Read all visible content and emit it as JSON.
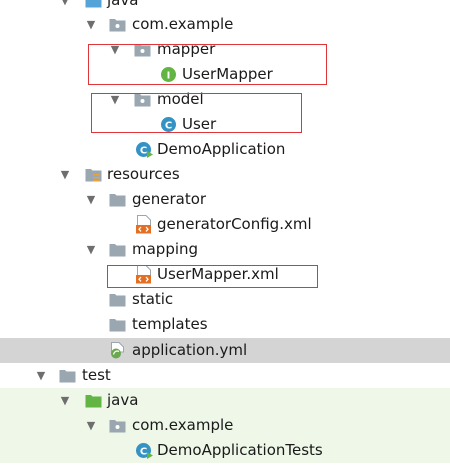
{
  "tree": {
    "java_top_label": "java",
    "com_example_label": "com.example",
    "mapper_label": "mapper",
    "usermapper_label": "UserMapper",
    "interface_badge": "I",
    "model_label": "model",
    "user_label": "User",
    "class_badge": "C",
    "demoapplication_label": "DemoApplication",
    "resources_label": "resources",
    "generator_label": "generator",
    "generatorconfig_label": "generatorConfig.xml",
    "mapping_label": "mapping",
    "usermapper_xml_label": "UserMapper.xml",
    "static_label": "static",
    "templates_label": "templates",
    "application_yml_label": "application.yml",
    "test_label": "test",
    "test_java_label": "java",
    "test_com_example_label": "com.example",
    "demoapplicationtests_label": "DemoApplicationTests"
  },
  "colors": {
    "selection": "#d4d4d4",
    "highlight_box": "#e0353a",
    "interface_badge": "#62b543",
    "class_badge": "#3592c4",
    "xml_icon": "#e16f24",
    "folder": "#9aa7b0",
    "source_folder": "#55a4d8",
    "test_folder": "#62b543",
    "test_tint": "#eef7e8"
  }
}
